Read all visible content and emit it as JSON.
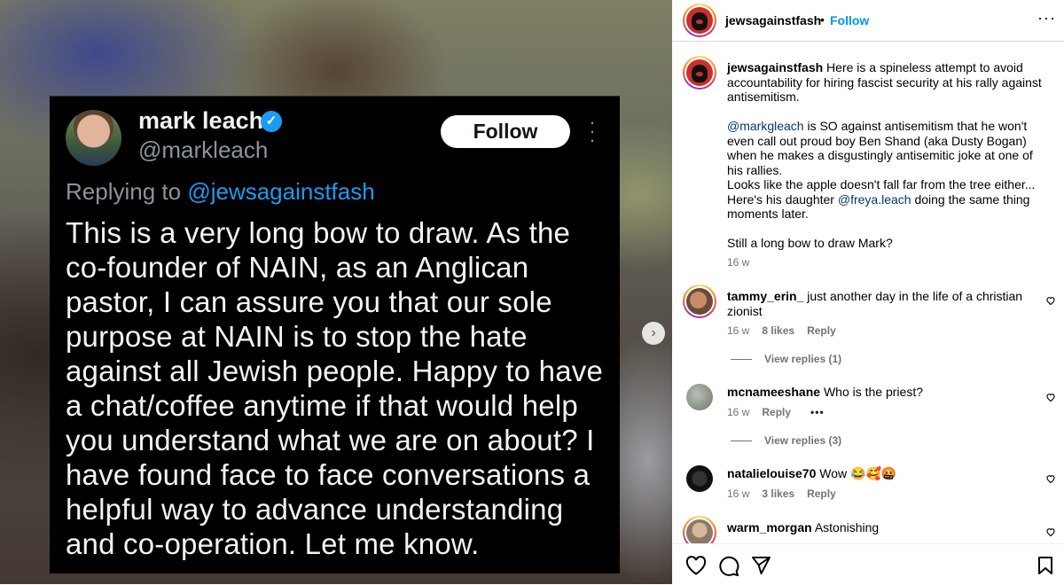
{
  "post": {
    "tweet": {
      "name": "mark leach",
      "handle": "@markleach",
      "follow_label": "Follow",
      "replying_prefix": "Replying to",
      "replying_handle": "@jewsagainstfash",
      "body": "This is a very long bow to draw. As the co-founder of NAIN, as an Anglican pastor, I can assure you that our sole purpose at NAIN is to stop the hate against all Jewish people. Happy to have a chat/coffee anytime if that would help you understand what we are on about? I have found face to face conversations a helpful way to advance understanding and co-operation. Let me know."
    },
    "next_arrow": "›"
  },
  "header": {
    "username": "jewsagainstfash",
    "dot": "•",
    "follow_label": "Follow",
    "more": "···"
  },
  "caption": {
    "username": "jewsagainstfash",
    "p1": "Here is a spineless attempt to avoid accountability for hiring fascist security at his rally against antisemitism.",
    "p2_mention": "@markgleach",
    "p2_rest": "is SO against antisemitism that he won't even call out proud boy Ben Shand (aka Dusty Bogan) when he makes a disgustingly antisemitic joke at one of his rallies.",
    "p3_a": "Looks like the apple doesn't fall far from the tree either... Here's his daughter",
    "p3_mention": "@freya.leach",
    "p3_b": "doing the same thing moments later.",
    "p4": "Still a long bow to draw Mark?",
    "time": "16 w"
  },
  "comments": [
    {
      "username": "tammy_erin_",
      "text": "just another day in the life of a christian zionist",
      "time": "16 w",
      "likes": "8 likes",
      "reply": "Reply",
      "view_replies": "View replies (1)"
    },
    {
      "username": "mcnameeshane",
      "text": "Who is the priest?",
      "time": "16 w",
      "reply": "Reply",
      "more": "•••",
      "view_replies": "View replies (3)"
    },
    {
      "username": "natalielouise70",
      "text": "Wow 😂🥰🤬",
      "time": "16 w",
      "likes": "3 likes",
      "reply": "Reply"
    },
    {
      "username": "warm_morgan",
      "text": "Astonishing"
    }
  ],
  "colors": {
    "link": "#0095f6",
    "mention": "#00376b",
    "meta": "#737373",
    "verified": "#1d9bf0"
  },
  "icons": [
    "heart-icon",
    "comment-icon",
    "share-icon",
    "bookmark-icon",
    "verified-icon",
    "chevron-right-icon"
  ]
}
